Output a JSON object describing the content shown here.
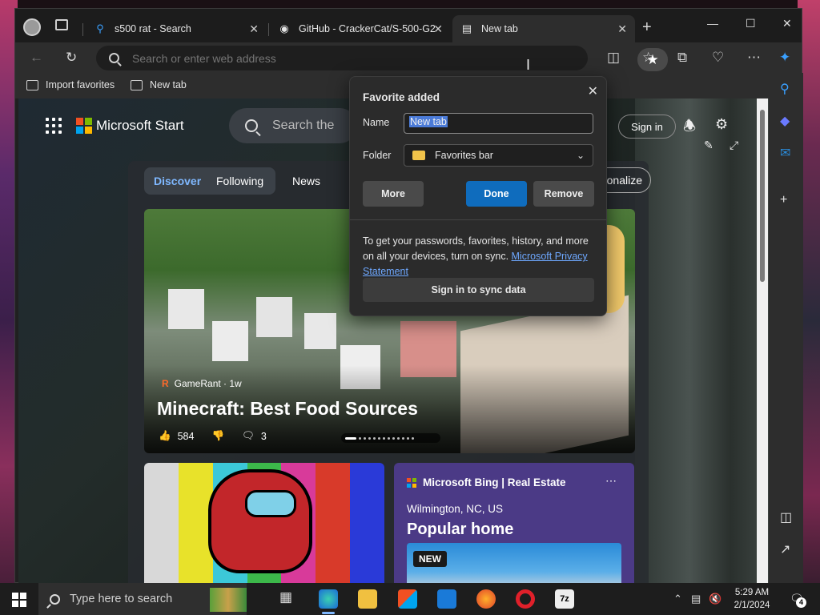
{
  "tabs": [
    {
      "title": "s500 rat - Search",
      "favicon": "search-icon"
    },
    {
      "title": "GitHub - CrackerCat/S-500-G2",
      "favicon": "github-icon"
    },
    {
      "title": "New tab",
      "favicon": "newtab-icon",
      "active": true
    }
  ],
  "address_bar": {
    "placeholder": "Search or enter web address"
  },
  "favorites_bar": {
    "items": [
      "Import favorites",
      "New tab"
    ]
  },
  "page": {
    "brand": "Microsoft Start",
    "search_placeholder": "Search the",
    "sign_in": "Sign in",
    "feed_tabs": [
      "Discover",
      "Following",
      "News"
    ],
    "personalize": "onalize",
    "hero": {
      "source": "GameRant · 1w",
      "title": "Minecraft: Best Food Sources",
      "likes": "584",
      "comments": "3"
    },
    "bing_card": {
      "source": "Microsoft Bing | Real Estate",
      "location": "Wilmington, NC, US",
      "title": "Popular home",
      "badge": "NEW"
    }
  },
  "dialog": {
    "title": "Favorite added",
    "name_label": "Name",
    "name_value": "New tab",
    "folder_label": "Folder",
    "folder_value": "Favorites bar",
    "more_button": "More",
    "done_button": "Done",
    "remove_button": "Remove",
    "sync_text": "To get your passwords, favorites, history, and more on all your devices, turn on sync. ",
    "privacy_link": "Microsoft Privacy Statement",
    "sync_button": "Sign in to sync data"
  },
  "taskbar": {
    "search_placeholder": "Type here to search",
    "time": "5:29 AM",
    "date": "2/1/2024",
    "notifications": "4"
  },
  "colors": {
    "accent": "#0f6cbd",
    "link": "#6ea8ff"
  }
}
